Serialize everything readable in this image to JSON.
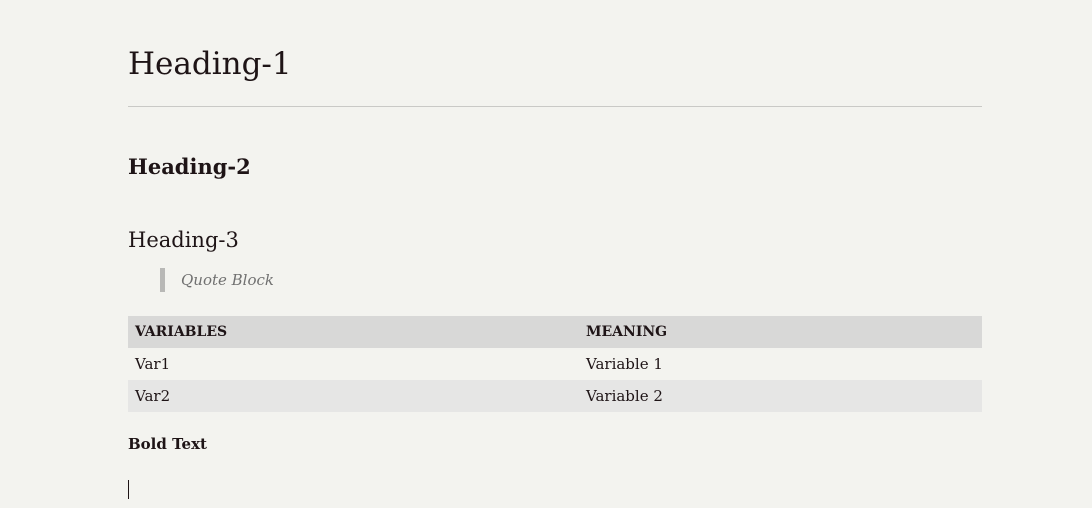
{
  "document": {
    "heading1": "Heading-1",
    "heading2": "Heading-2",
    "heading3": "Heading-3",
    "quote": "Quote Block",
    "table": {
      "headers": [
        "VARIABLES",
        "MEANING"
      ],
      "rows": [
        [
          "Var1",
          "Variable 1"
        ],
        [
          "Var2",
          "Variable 2"
        ]
      ]
    },
    "bold_text": "Bold Text"
  },
  "colors": {
    "background": "#f3f3ef",
    "text": "#1e1416",
    "table_header": "#d8d8d7",
    "table_stripe": "#e6e6e5",
    "quote_bar": "#b8b8b6"
  }
}
